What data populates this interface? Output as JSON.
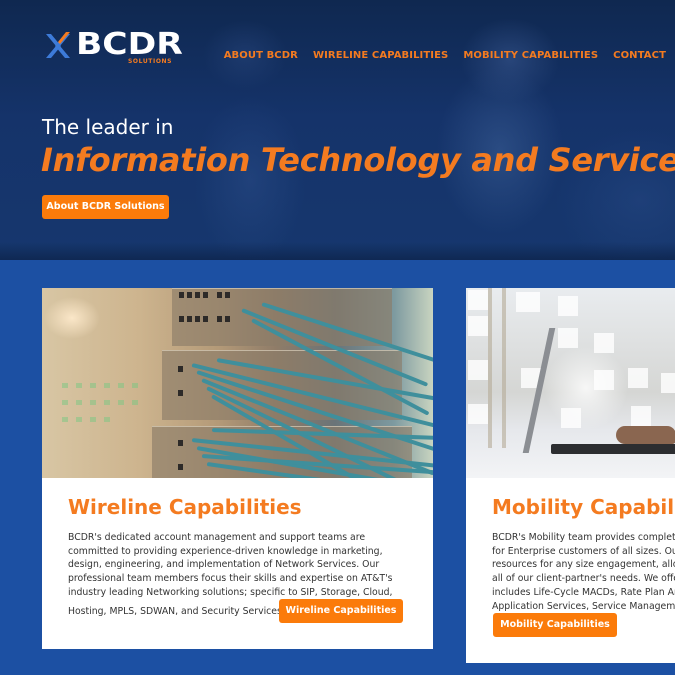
{
  "header": {
    "logo": {
      "text": "BCDR",
      "subtext": "SOLUTIONS",
      "icon": "crossed-arrows-logo-icon"
    },
    "nav": [
      {
        "label": "ABOUT BCDR"
      },
      {
        "label": "WIRELINE CAPABILITIES"
      },
      {
        "label": "MOBILITY CAPABILITIES"
      },
      {
        "label": "CONTACT"
      }
    ]
  },
  "hero": {
    "subtitle": "The leader in",
    "title": "Information Technology and Services",
    "button_label": "About BCDR Solutions"
  },
  "cards": [
    {
      "title": "Wireline Capabilities",
      "image": "network-switch-cables-photo",
      "body_lines": [
        "BCDR's dedicated account management and support teams are",
        "committed to providing experience-driven knowledge in marketing,",
        "design, engineering, and implementation of Network Services. Our",
        "professional team members focus their skills and expertise on AT&T's",
        "industry leading Networking solutions; specific to SIP, Storage, Cloud,",
        "Hosting, MPLS, SDWAN, and Security Services."
      ],
      "button_label": "Wireline Capabilities"
    },
    {
      "title": "Mobility Capabilities",
      "image": "laptop-typing-photo",
      "body_lines": [
        "BCDR's Mobility team provides complete",
        "for Enterprise customers of all sizes. Our",
        "resources for any size engagement, allow",
        "all of our client-partner's needs. We offer",
        "includes Life-Cycle MACDs, Rate Plan An",
        "Application Services, Service Manageme"
      ],
      "button_label": "Mobility Capabilities"
    }
  ],
  "colors": {
    "accent_orange": "#f47b20",
    "button_orange": "#fb7b0a",
    "section_blue": "#1c50a3",
    "hero_navy": "#15336a"
  }
}
